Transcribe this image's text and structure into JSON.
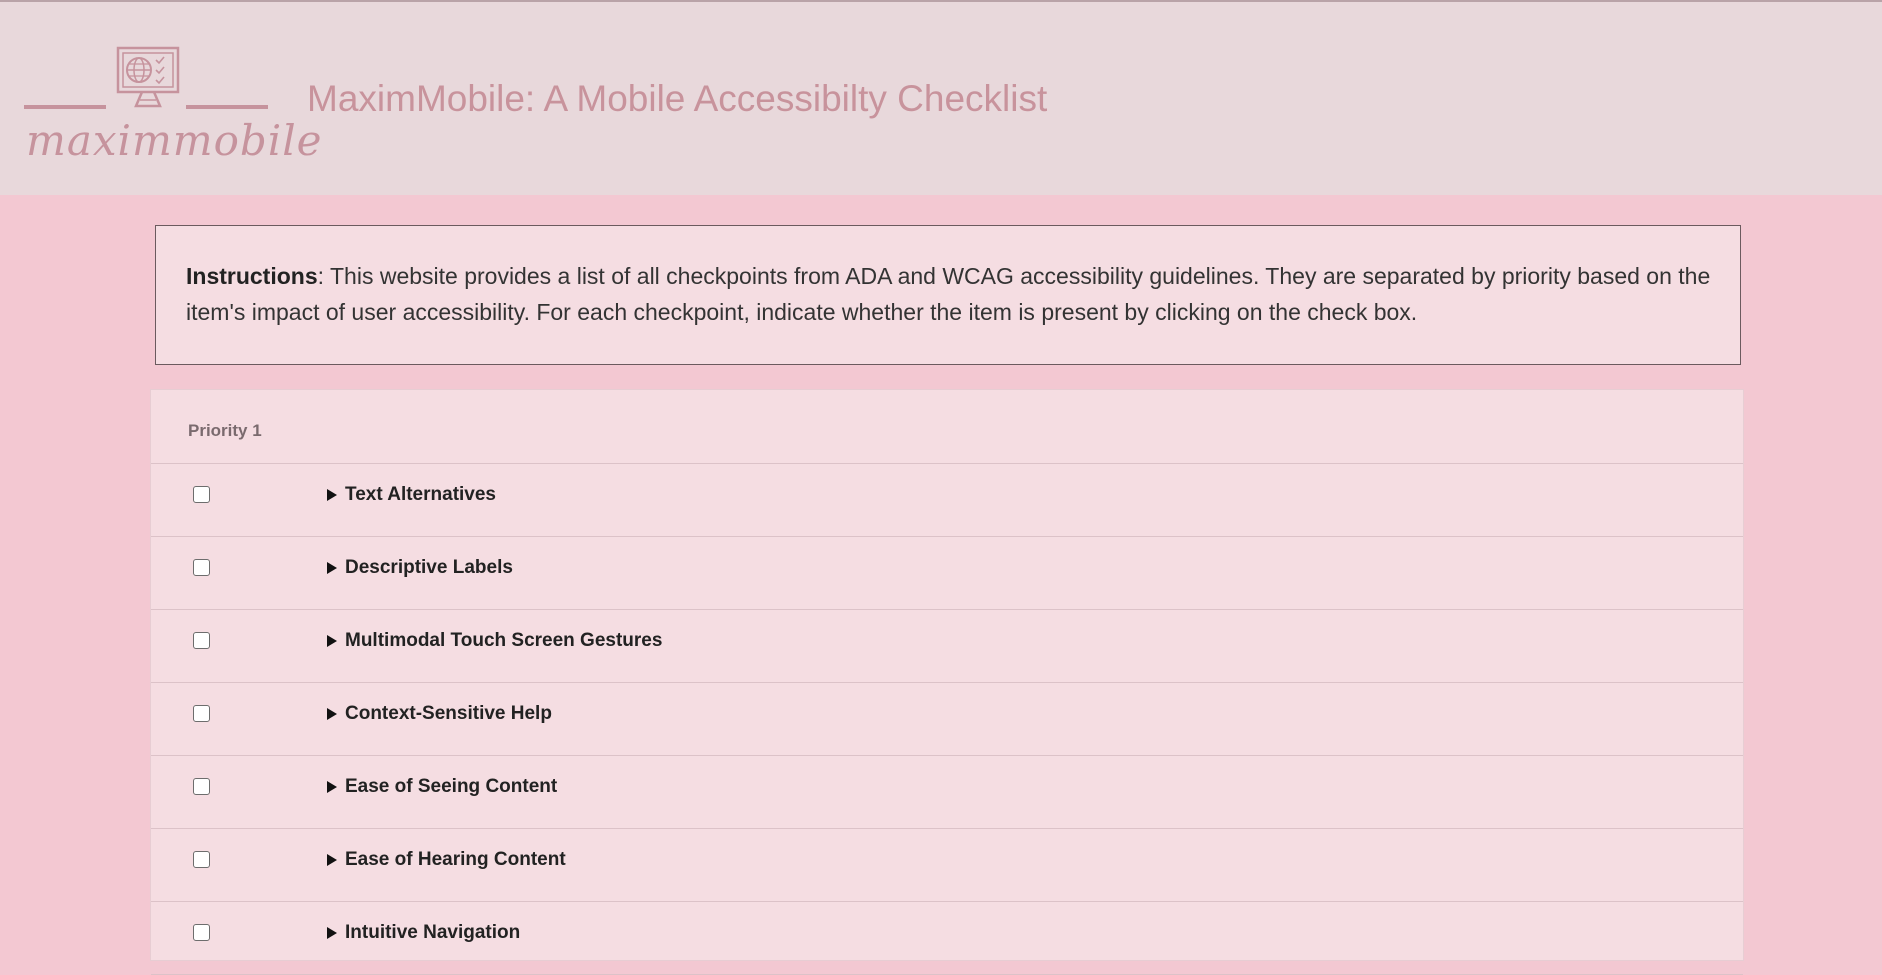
{
  "header": {
    "logo_text": "maximmobile",
    "title": "MaximMobile: A Mobile Accessibilty Checklist"
  },
  "instructions": {
    "label": "Instructions",
    "text": ": This website provides a list of all checkpoints from ADA and WCAG accessibility guidelines. They are separated by priority based on the item's impact of user accessibility. For each checkpoint, indicate whether the item is present by clicking on the check box."
  },
  "priority": {
    "heading": "Priority 1",
    "items": [
      {
        "label": "Text Alternatives",
        "checked": false
      },
      {
        "label": "Descriptive Labels",
        "checked": false
      },
      {
        "label": "Multimodal Touch Screen Gestures",
        "checked": false
      },
      {
        "label": "Context-Sensitive Help",
        "checked": false
      },
      {
        "label": "Ease of Seeing Content",
        "checked": false
      },
      {
        "label": "Ease of Hearing Content",
        "checked": false
      },
      {
        "label": "Intuitive Navigation",
        "checked": false
      }
    ]
  },
  "colors": {
    "page_background": "#f3c8d2",
    "header_background": "#e8d8db",
    "accent": "#c8939c"
  }
}
